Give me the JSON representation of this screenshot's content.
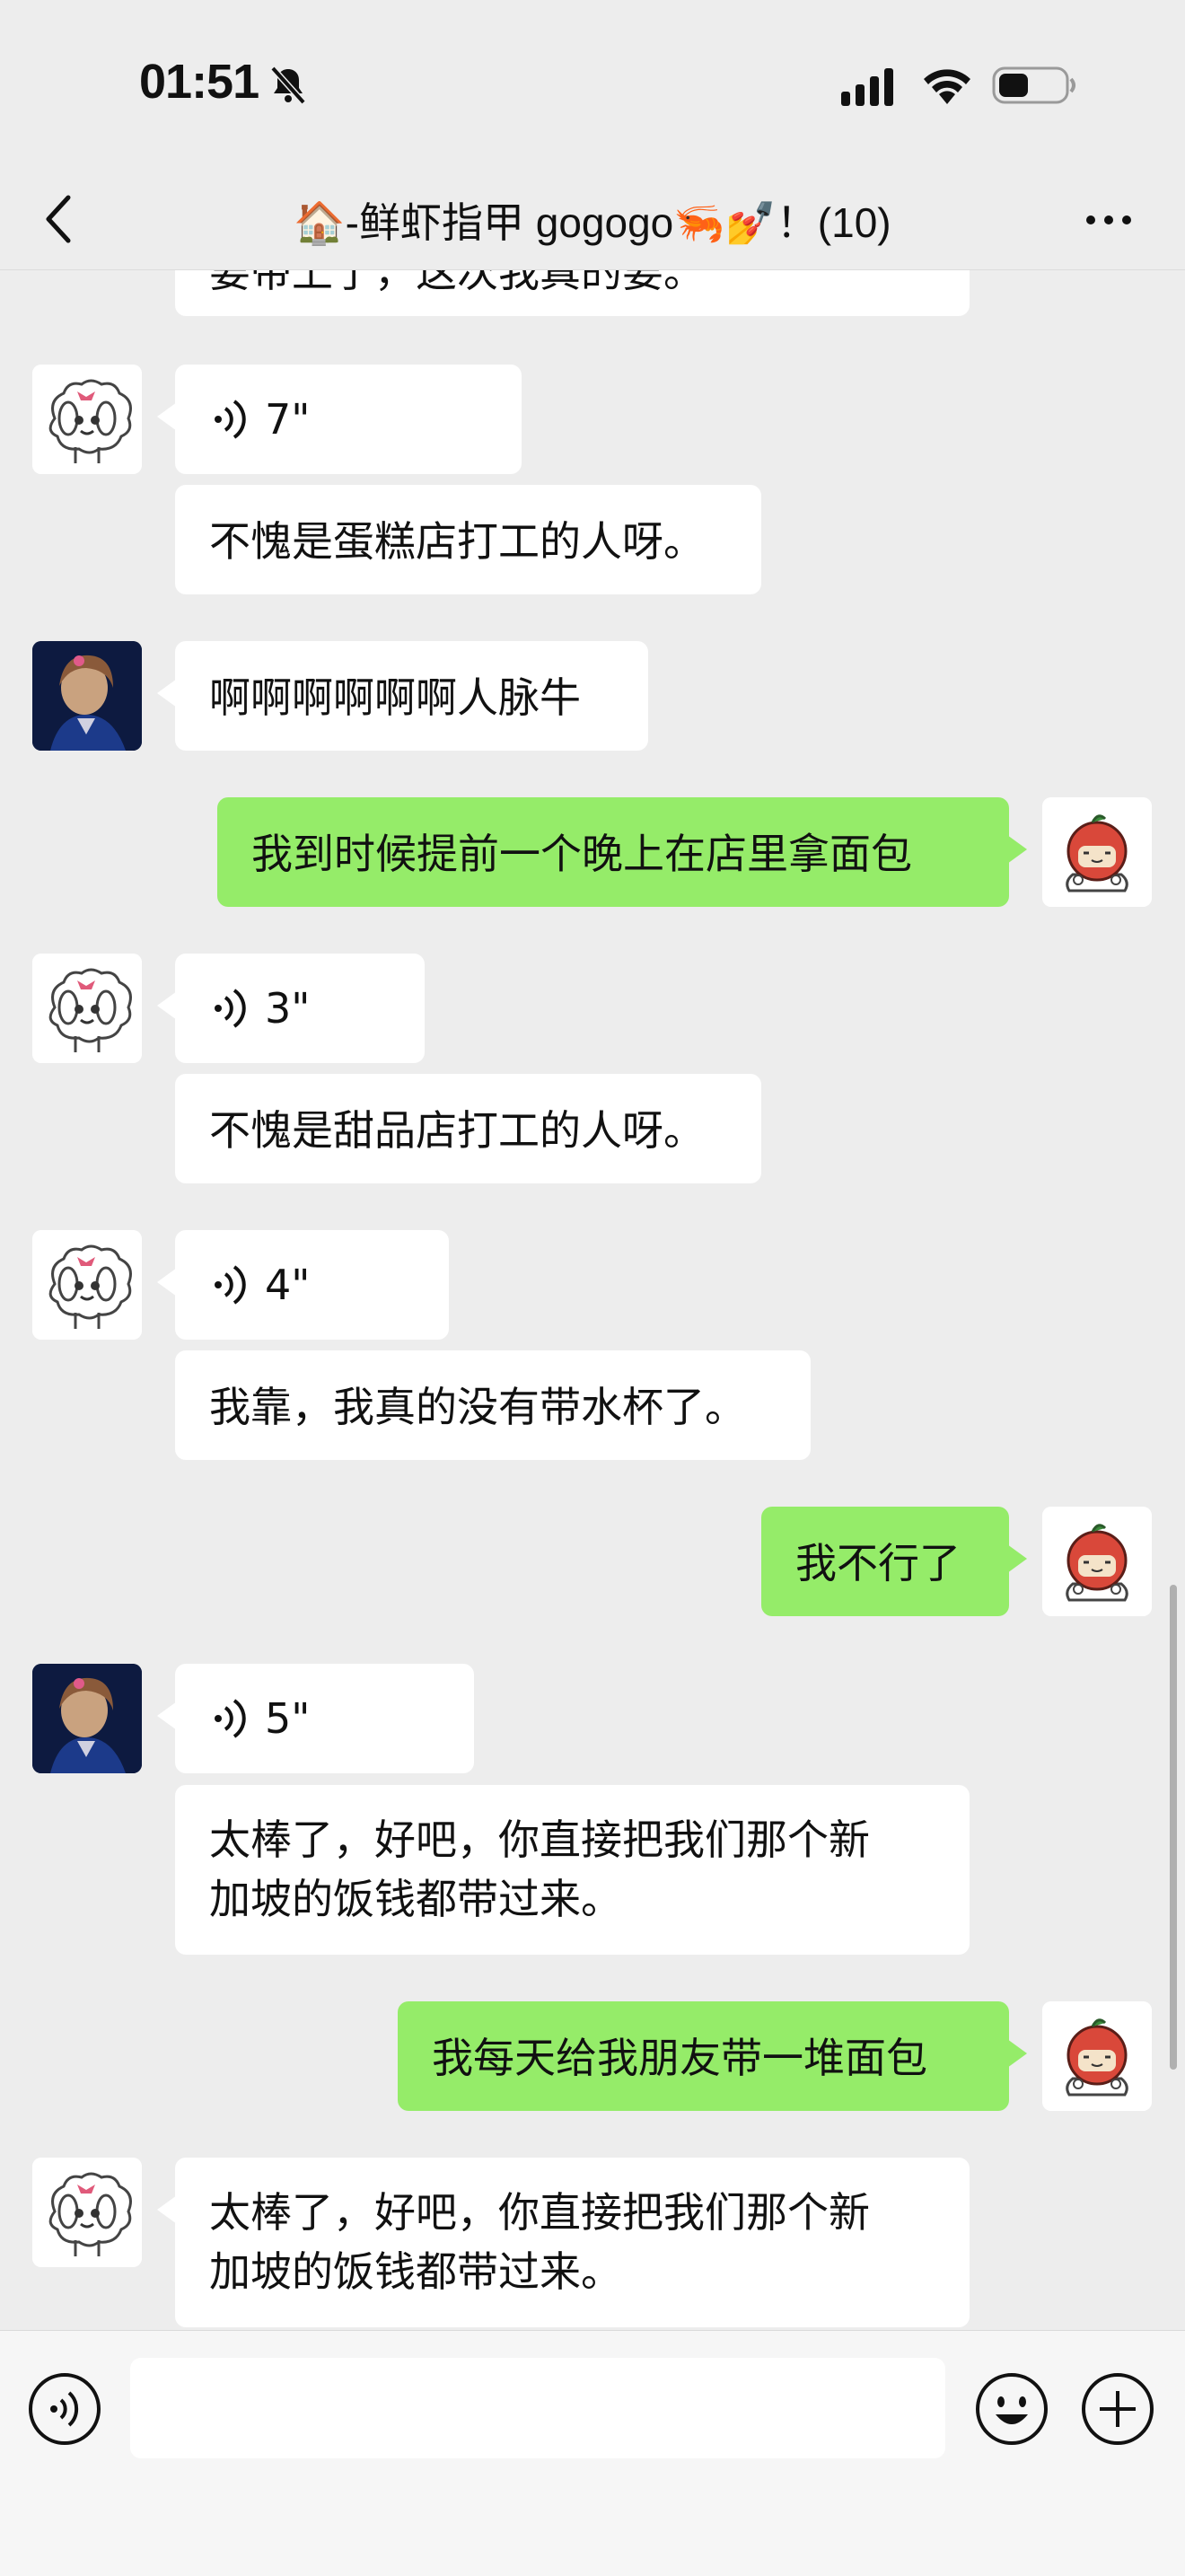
{
  "status": {
    "time": "01:51"
  },
  "nav": {
    "title": "🏠-鲜虾指甲 gogogo🦐💅！(10)"
  },
  "messages": {
    "m0_partial": "要带上了，这次我真的要。",
    "m1_voice": "7\"",
    "m2": "不愧是蛋糕店打工的人呀。",
    "m3": "啊啊啊啊啊啊人脉牛",
    "m4": "我到时候提前一个晚上在店里拿面包",
    "m5_voice": "3\"",
    "m6": "不愧是甜品店打工的人呀。",
    "m7_voice": "4\"",
    "m8": "我靠，我真的没有带水杯了。",
    "m9": "我不行了",
    "m10_voice": "5\"",
    "m11_line1": "太棒了，好吧，你直接把我们那个新",
    "m11_line2": "加坡的饭钱都带过来。",
    "m12": "我每天给我朋友带一堆面包",
    "m13_line1": "太棒了，好吧，你直接把我们那个新",
    "m13_line2": "加坡的饭钱都带过来。"
  },
  "input": {
    "placeholder": ""
  },
  "colors": {
    "background": "#ededed",
    "my_bubble": "#95ec69",
    "other_bubble": "#ffffff"
  }
}
